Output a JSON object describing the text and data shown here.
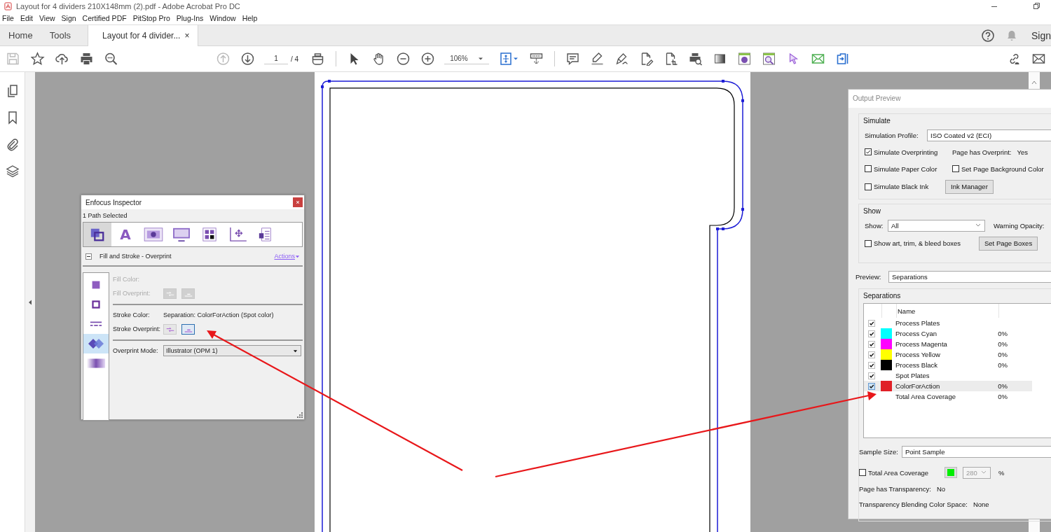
{
  "window": {
    "title": "Layout for 4 dividers 210X148mm (2).pdf - Adobe Acrobat Pro DC"
  },
  "menu": [
    "File",
    "Edit",
    "View",
    "Sign",
    "Certified PDF",
    "PitStop Pro",
    "Plug-Ins",
    "Window",
    "Help"
  ],
  "tabs": [
    {
      "label": "Home",
      "selected": false
    },
    {
      "label": "Tools",
      "selected": false
    },
    {
      "label": "Layout for 4 divider...",
      "selected": true,
      "close": "×"
    }
  ],
  "account": {
    "sign_in": "Sign"
  },
  "toolbar": {
    "page": "1",
    "page_total": "/ 4",
    "zoom": "106%"
  },
  "inspector": {
    "title": "Enfocus Inspector",
    "status": "1 Path Selected",
    "tabs": [
      {
        "kind": "fill-stroke",
        "selected": true
      },
      {
        "kind": "text",
        "glyph": "A",
        "selected": false
      },
      {
        "kind": "image",
        "selected": false
      },
      {
        "kind": "display",
        "selected": false
      },
      {
        "kind": "separations",
        "selected": false
      },
      {
        "kind": "position",
        "selected": false
      },
      {
        "kind": "document",
        "selected": false
      }
    ],
    "section": "Fill and Stroke - Overprint",
    "actions": "Actions",
    "side_tabs": [
      {
        "kind": "fill",
        "selected": false
      },
      {
        "kind": "stroke",
        "selected": false
      },
      {
        "kind": "dash",
        "selected": false
      },
      {
        "kind": "overprint",
        "selected": true
      },
      {
        "kind": "transparency",
        "selected": false
      }
    ],
    "fill": {
      "color_label": "Fill Color:",
      "overprint_label": "Fill Overprint:",
      "disabled": true,
      "overprint": [
        {
          "selected": false
        },
        {
          "selected": false
        }
      ]
    },
    "stroke": {
      "color_label": "Stroke Color:",
      "color_value": "Separation: ColorForAction (Spot color)",
      "overprint_label": "Stroke Overprint:",
      "overprint": [
        {
          "selected": false
        },
        {
          "selected": true
        }
      ]
    },
    "overprint_mode": {
      "label": "Overprint Mode:",
      "value": "Illustrator (OPM 1)"
    }
  },
  "output_preview": {
    "title": "Output Preview",
    "simulate": {
      "legend": "Simulate",
      "profile_label": "Simulation Profile:",
      "profile": "ISO Coated v2 (ECI)",
      "overprinting": {
        "label": "Simulate Overprinting",
        "checked": true
      },
      "has_overprint_label": "Page has Overprint:",
      "has_overprint": "Yes",
      "paper_color": {
        "label": "Simulate Paper Color",
        "checked": false
      },
      "background_color": {
        "label": "Set Page Background Color",
        "checked": false
      },
      "black_ink": {
        "label": "Simulate Black Ink",
        "checked": false
      },
      "ink_manager": "Ink Manager"
    },
    "show": {
      "legend": "Show",
      "show_label": "Show:",
      "show_value": "All",
      "warning_label": "Warning Opacity:",
      "boxes": {
        "label": "Show art, trim, & bleed boxes",
        "checked": false
      },
      "page_boxes": "Set Page Boxes"
    },
    "preview_label": "Preview:",
    "preview": "Separations",
    "separations": {
      "legend": "Separations",
      "name_header": "Name",
      "rows": [
        {
          "kind": "group",
          "name": "Process Plates",
          "checked": true,
          "selected": false
        },
        {
          "kind": "ink",
          "name": "Process Cyan",
          "color": "#00ffff",
          "value": "0%",
          "checked": true,
          "selected": false
        },
        {
          "kind": "ink",
          "name": "Process Magenta",
          "color": "#ff00ff",
          "value": "0%",
          "checked": true,
          "selected": false
        },
        {
          "kind": "ink",
          "name": "Process Yellow",
          "color": "#ffff00",
          "value": "0%",
          "checked": true,
          "selected": false
        },
        {
          "kind": "ink",
          "name": "Process Black",
          "color": "#000000",
          "value": "0%",
          "checked": true,
          "selected": false
        },
        {
          "kind": "group",
          "name": "Spot Plates",
          "checked": true,
          "selected": false
        },
        {
          "kind": "ink",
          "name": "ColorForAction",
          "color": "#e02027",
          "value": "0%",
          "checked": true,
          "selected": true
        },
        {
          "kind": "total",
          "name": "Total Area Coverage",
          "value": "0%",
          "selected": false
        }
      ]
    },
    "sample_label": "Sample Size:",
    "sample": "Point Sample",
    "coverage": {
      "label": "Total Area Coverage",
      "checked": false,
      "color": "#00ee00",
      "value": "280",
      "unit": "%"
    },
    "transparency_label": "Page has Transparency:",
    "transparency": "No",
    "blending_label": "Transparency Blending Color Space:",
    "blending": "None"
  }
}
